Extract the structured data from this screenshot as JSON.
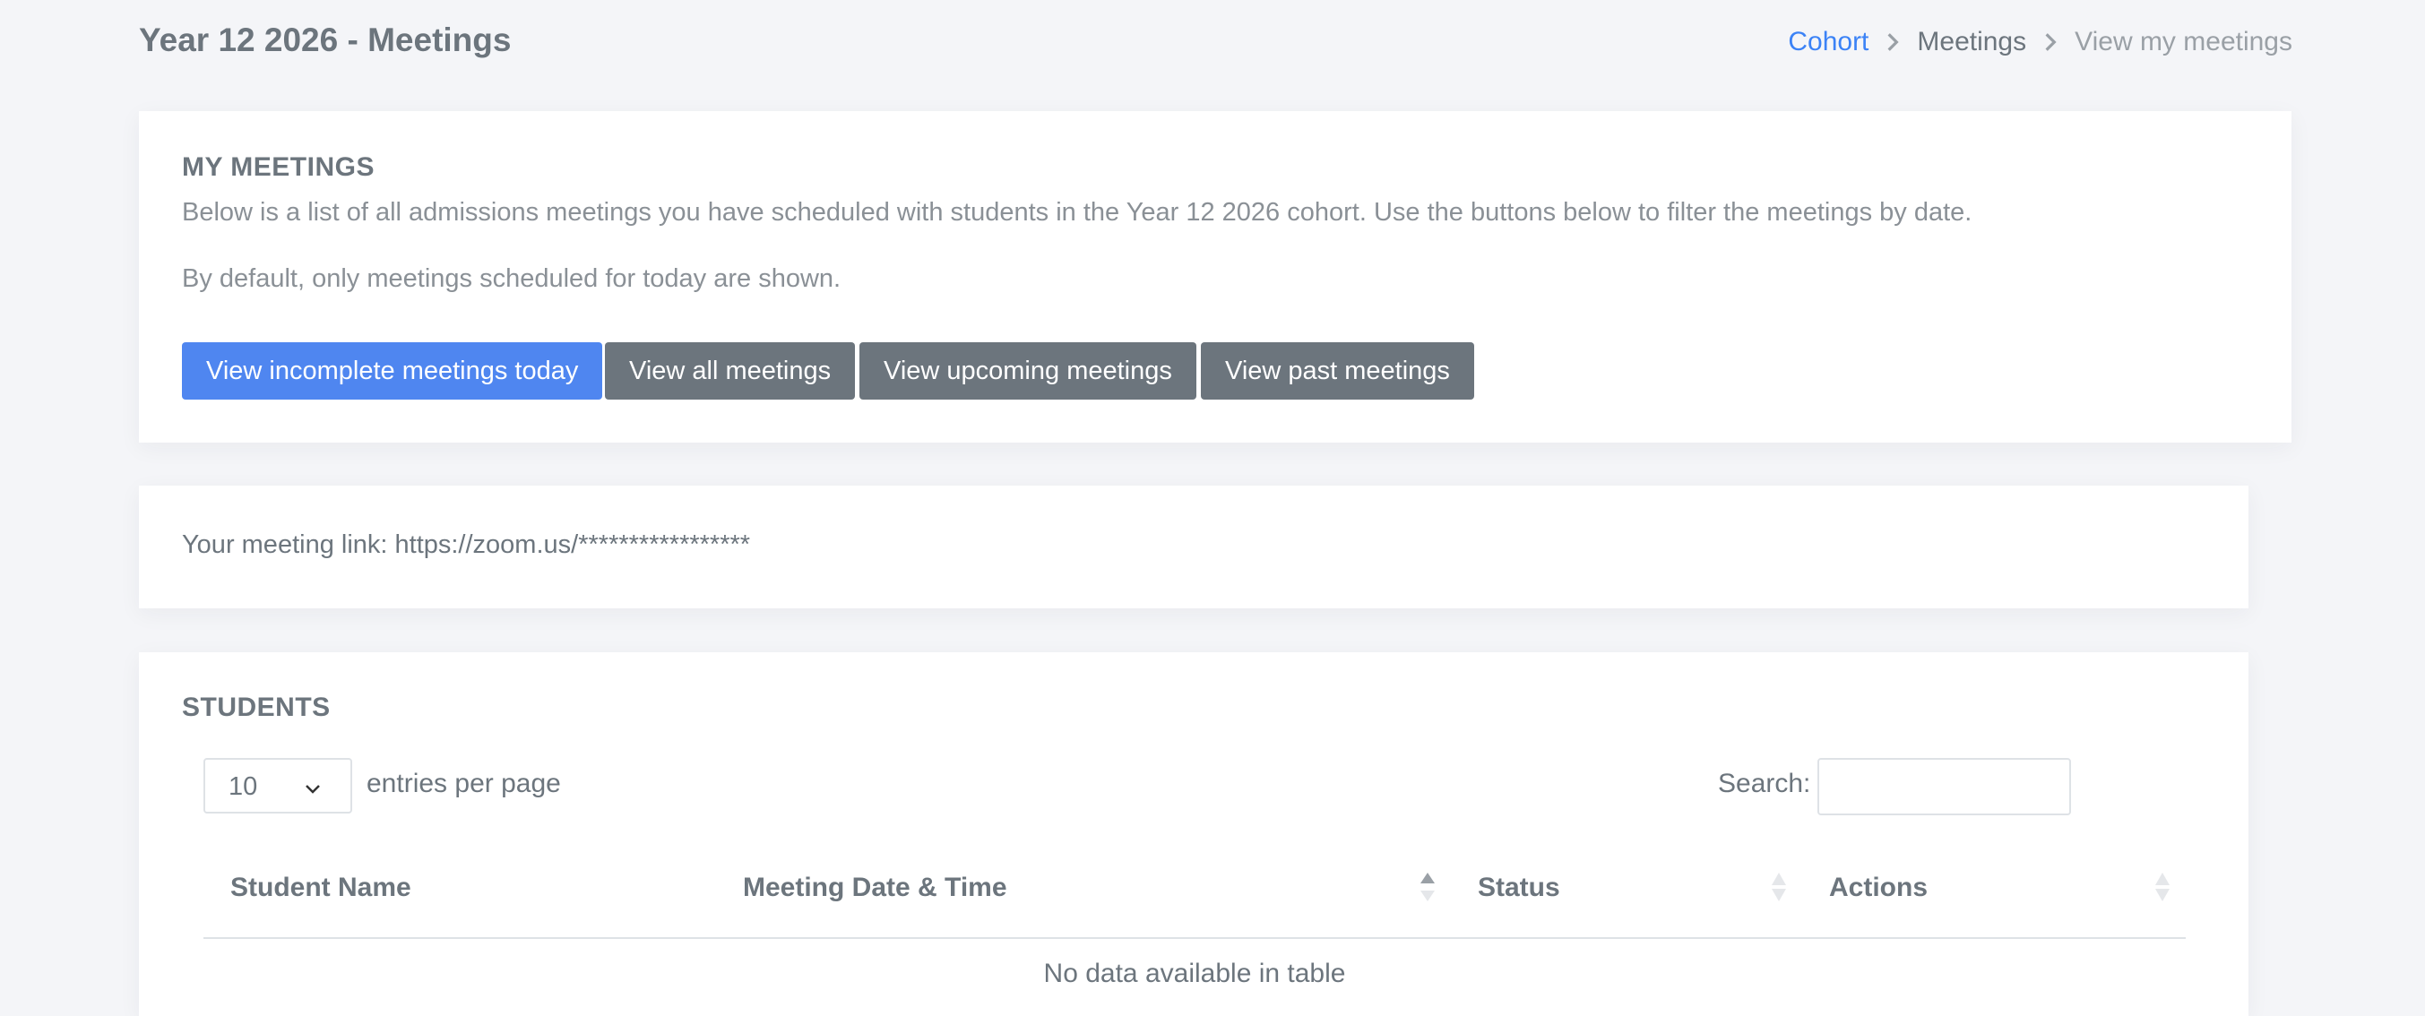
{
  "page": {
    "title": "Year 12 2026 - Meetings"
  },
  "breadcrumb": {
    "items": [
      {
        "label": "Cohort"
      },
      {
        "label": "Meetings"
      },
      {
        "label": "View my meetings"
      }
    ]
  },
  "my_meetings": {
    "heading": "MY MEETINGS",
    "description": "Below is a list of all admissions meetings you have scheduled with students in the Year 12 2026 cohort. Use the buttons below to filter the meetings by date.",
    "default_note": "By default, only meetings scheduled for today are shown.",
    "buttons": {
      "incomplete_today": "View incomplete meetings today",
      "all": "View all meetings",
      "upcoming": "View upcoming meetings",
      "past": "View past meetings"
    }
  },
  "meeting_link": {
    "text": "Your meeting link: https://zoom.us/*****************"
  },
  "students": {
    "heading": "STUDENTS",
    "entries_per_page_value": "10",
    "entries_per_page_label": "entries per page",
    "search_label": "Search:",
    "search_value": "",
    "columns": [
      {
        "label": "Student Name"
      },
      {
        "label": "Meeting Date & Time"
      },
      {
        "label": "Status"
      },
      {
        "label": "Actions"
      }
    ],
    "empty_message": "No data available in table"
  },
  "colors": {
    "background": "#f4f5f8",
    "card": "#ffffff",
    "primary": "#4f86f0",
    "secondary": "#6c757d",
    "link": "#3b82f6",
    "text": "#6c757d"
  },
  "icons": {
    "breadcrumb_separator": "chevron-right-icon",
    "select_arrow": "chevron-down-icon",
    "sort_ascending": "sort-asc-icon",
    "sort_both": "sort-both-icon"
  }
}
